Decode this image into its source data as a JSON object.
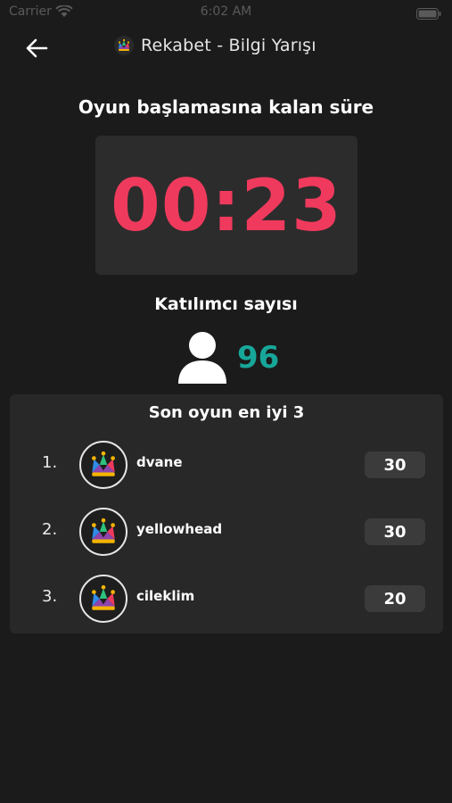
{
  "status_bar": {
    "carrier": "Carrier",
    "time": "6:02 AM"
  },
  "nav": {
    "title": "Rekabet - Bilgi Yarışı",
    "back_icon": "arrow-left-icon",
    "logo_icon": "jester-crown-icon"
  },
  "countdown": {
    "heading": "Oyun başlamasına kalan süre",
    "value": "00:23",
    "color": "#ef3a5d"
  },
  "participants": {
    "heading": "Katılımcı sayısı",
    "count": "96",
    "icon": "person-icon",
    "count_color": "#17a79a"
  },
  "leaderboard": {
    "title": "Son oyun en iyi 3",
    "rows": [
      {
        "rank": "1.",
        "name": "dvane",
        "score": "30",
        "avatar_icon": "jester-crown-icon"
      },
      {
        "rank": "2.",
        "name": "yellowhead",
        "score": "30",
        "avatar_icon": "jester-crown-icon"
      },
      {
        "rank": "3.",
        "name": "cileklim",
        "score": "20",
        "avatar_icon": "jester-crown-icon"
      }
    ]
  }
}
